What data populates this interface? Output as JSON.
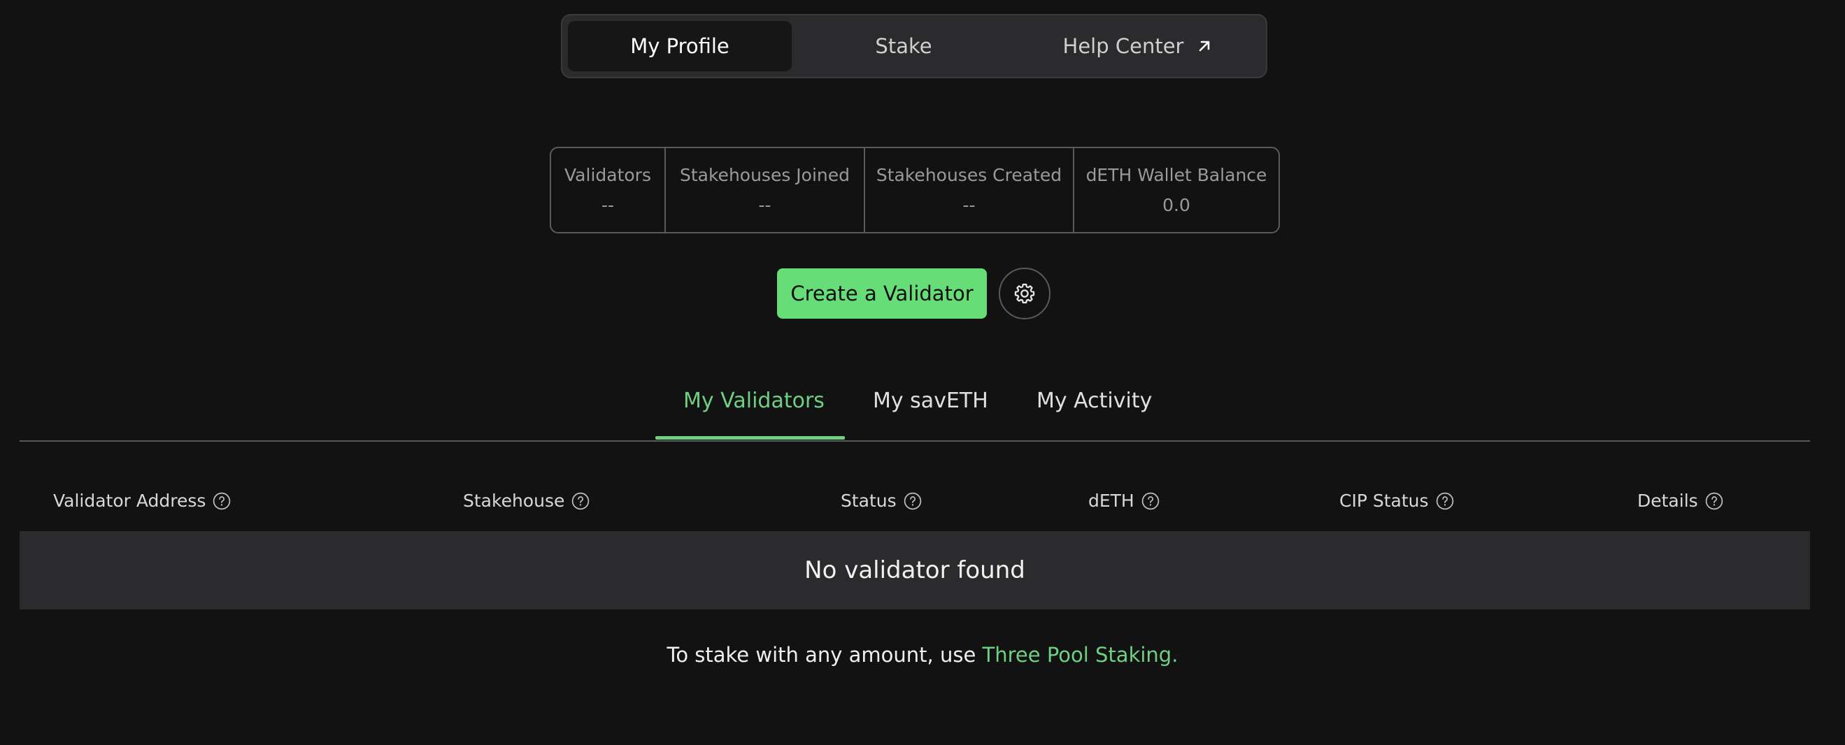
{
  "topnav": {
    "items": [
      {
        "label": "My Profile",
        "active": true
      },
      {
        "label": "Stake",
        "active": false
      },
      {
        "label": "Help Center",
        "active": false,
        "icon": "external-arrow-icon"
      }
    ]
  },
  "stats": [
    {
      "label": "Validators",
      "value": "--"
    },
    {
      "label": "Stakehouses Joined",
      "value": "--"
    },
    {
      "label": "Stakehouses Created",
      "value": "--"
    },
    {
      "label": "dETH Wallet Balance",
      "value": "0.0"
    }
  ],
  "actions": {
    "create_label": "Create a Validator",
    "settings_icon": "gear-icon"
  },
  "tabs": [
    {
      "label": "My Validators",
      "active": true
    },
    {
      "label": "My savETH",
      "active": false
    },
    {
      "label": "My Activity",
      "active": false
    }
  ],
  "table": {
    "columns": [
      {
        "label": "Validator Address"
      },
      {
        "label": "Stakehouse"
      },
      {
        "label": "Status"
      },
      {
        "label": "dETH"
      },
      {
        "label": "CIP Status"
      },
      {
        "label": "Details"
      }
    ],
    "empty_message": "No validator found"
  },
  "footer": {
    "prefix": "To stake with any amount, use ",
    "link_label": "Three Pool Staking."
  },
  "colors": {
    "background": "#121212",
    "accent": "#66dd77",
    "accent_text": "#6fcf83",
    "panel": "#2b2b2d"
  }
}
